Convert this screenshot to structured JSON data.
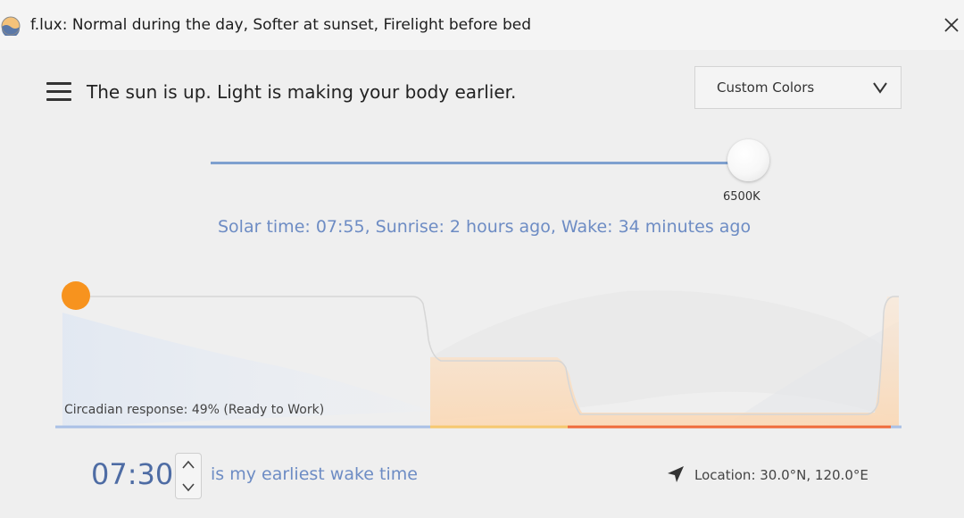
{
  "window": {
    "title": "f.lux: Normal during the day, Softer at sunset, Firelight before bed"
  },
  "header": {
    "status": "The sun is up. Light is making your body earlier.",
    "preset": {
      "selected": "Custom Colors"
    }
  },
  "slider": {
    "value_label": "6500K",
    "level": 1.0
  },
  "solar": {
    "text": "Solar time: 07:55, Sunrise: 2 hours ago, Wake: 34 minutes ago"
  },
  "graph": {
    "circadian": "Circadian response: 49% (Ready to Work)",
    "colors": {
      "day": "#a9c0e6",
      "sunset": "#f6c76e",
      "night": "#ef6a3a",
      "sun": "#f7931e"
    }
  },
  "footer": {
    "wake_time": "07:30",
    "wake_label": "is my earliest wake time",
    "location": "Location: 30.0°N, 120.0°E"
  }
}
